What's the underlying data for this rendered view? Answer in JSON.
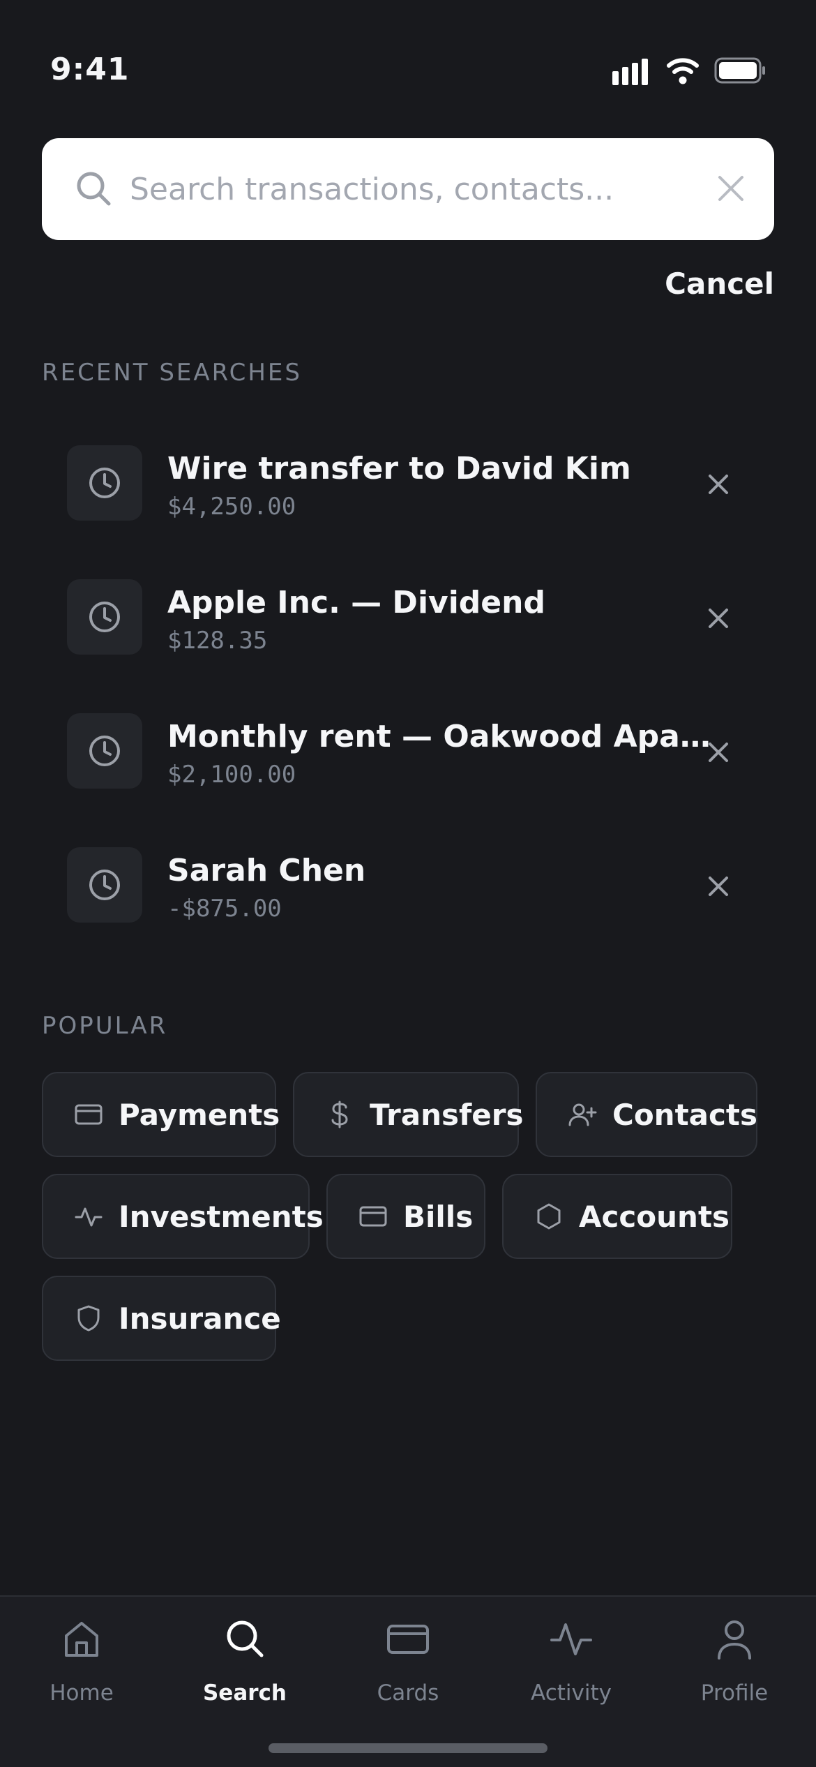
{
  "status_bar": {
    "time": "9:41"
  },
  "search": {
    "placeholder": "Search transactions, contacts...",
    "value": "",
    "cancel_label": "Cancel"
  },
  "recent": {
    "label": "RECENT SEARCHES",
    "items": [
      {
        "title": "Wire transfer to David Kim",
        "amount": "$4,250.00"
      },
      {
        "title": "Apple Inc. — Dividend",
        "amount": "$128.35"
      },
      {
        "title": "Monthly rent — Oakwood Apartments",
        "amount": "$2,100.00"
      },
      {
        "title": "Sarah Chen",
        "amount": "-$875.00"
      }
    ]
  },
  "popular": {
    "label": "POPULAR",
    "chips": [
      {
        "label": "Payments",
        "icon": "card-icon"
      },
      {
        "label": "Transfers",
        "icon": "dollar-icon"
      },
      {
        "label": "Contacts",
        "icon": "user-plus-icon"
      },
      {
        "label": "Investments",
        "icon": "activity-icon"
      },
      {
        "label": "Bills",
        "icon": "card-icon"
      },
      {
        "label": "Accounts",
        "icon": "hexagon-icon"
      },
      {
        "label": "Insurance",
        "icon": "shield-icon"
      }
    ]
  },
  "tabs": [
    {
      "label": "Home",
      "icon": "home-icon",
      "active": false
    },
    {
      "label": "Search",
      "icon": "search-icon",
      "active": true
    },
    {
      "label": "Cards",
      "icon": "card-icon",
      "active": false
    },
    {
      "label": "Activity",
      "icon": "activity-icon",
      "active": false
    },
    {
      "label": "Profile",
      "icon": "user-icon",
      "active": false
    }
  ],
  "colors": {
    "background": "#18191d",
    "surface": "#24262b",
    "muted_text": "#7d8490",
    "primary_text": "#f5f6f8"
  }
}
